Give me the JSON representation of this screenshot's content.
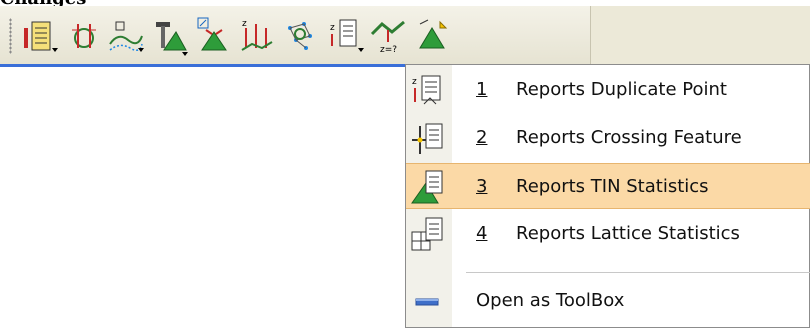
{
  "header": {
    "cut_text": "Changes"
  },
  "toolbar": {
    "buttons": [
      {
        "icon": "report-table-icon"
      },
      {
        "icon": "section-icon"
      },
      {
        "icon": "contour-icon"
      },
      {
        "icon": "hammer-triangle-icon"
      },
      {
        "icon": "tin-edit-icon"
      },
      {
        "icon": "elevation-icon"
      },
      {
        "icon": "points-network-icon"
      },
      {
        "icon": "reports-menu-icon"
      },
      {
        "icon": "surface-query-icon"
      },
      {
        "icon": "triangle-add-icon"
      }
    ]
  },
  "menu": {
    "items": [
      {
        "num": "1",
        "label": "Reports Duplicate Point",
        "icon": "duplicate-point-report-icon"
      },
      {
        "num": "2",
        "label": "Reports Crossing Feature",
        "icon": "crossing-feature-report-icon"
      },
      {
        "num": "3",
        "label": "Reports TIN Statistics",
        "icon": "tin-statistics-report-icon",
        "highlighted": true
      },
      {
        "num": "4",
        "label": "Reports Lattice Statistics",
        "icon": "lattice-statistics-report-icon"
      }
    ],
    "toolbox": {
      "label": "Open as ToolBox",
      "icon": "toolbox-icon"
    }
  },
  "colors": {
    "highlight": "#fbd9a6",
    "accent": "#3a6fd8"
  }
}
